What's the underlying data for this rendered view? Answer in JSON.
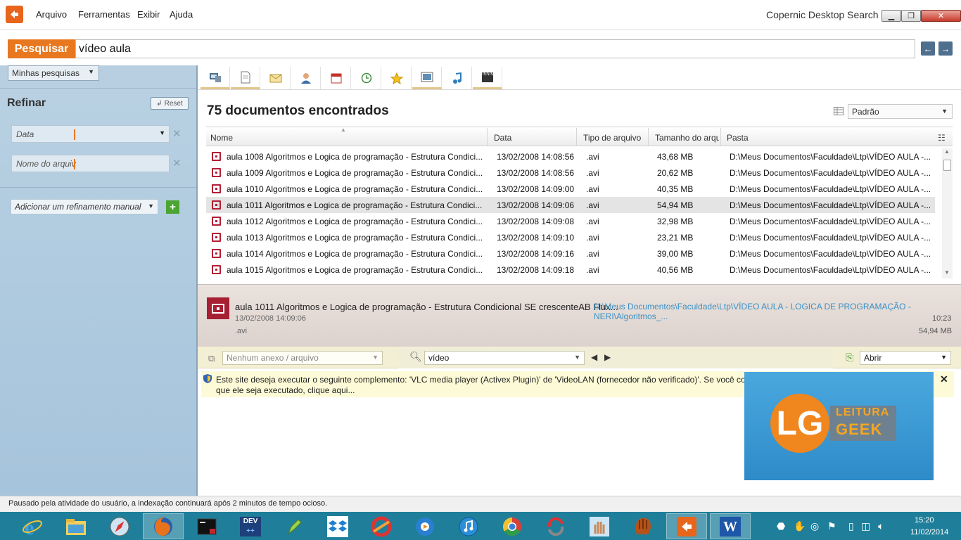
{
  "window": {
    "title": "Copernic Desktop Search",
    "minimize_icon": "minimize-icon",
    "maximize_icon": "restore-icon",
    "close_icon": "close-icon"
  },
  "menu": [
    "Arquivo",
    "Ferramentas",
    "Exibir",
    "Ajuda"
  ],
  "search": {
    "button_label": "Pesquisar",
    "query": "vídeo aula",
    "back_icon": "arrow-left-icon",
    "forward_icon": "arrow-right-icon"
  },
  "sidebar": {
    "my_searches": "Minhas pesquisas",
    "refine_title": "Refinar",
    "reset_label": "Reset",
    "filters": [
      {
        "label": "Data"
      },
      {
        "label": "Nome do arquiv"
      }
    ],
    "add_refine": "Adicionar um refinamento manual",
    "add_icon": "plus-icon"
  },
  "toolbar_icons": [
    "all-results-icon",
    "files-icon",
    "email-icon",
    "contacts-icon",
    "calendar-icon",
    "history-icon",
    "favorites-icon",
    "pictures-icon",
    "music-icon",
    "videos-icon"
  ],
  "results": {
    "count_label": "75 documentos encontrados",
    "sort": "Padrão",
    "columns": [
      "Nome",
      "Data",
      "Tipo de arquivo",
      "Tamanho do arqu",
      "Pasta"
    ],
    "rows": [
      {
        "name": "aula 1008 Algoritmos e Logica de programação - Estrutura Condici...",
        "date": "13/02/2008 14:08:56",
        "type": ".avi",
        "size": "43,68 MB",
        "path": "D:\\Meus Documentos\\Faculdade\\Ltp\\VÍDEO AULA -..."
      },
      {
        "name": "aula 1009 Algoritmos e Logica de programação - Estrutura Condici...",
        "date": "13/02/2008 14:08:56",
        "type": ".avi",
        "size": "20,62 MB",
        "path": "D:\\Meus Documentos\\Faculdade\\Ltp\\VÍDEO AULA -..."
      },
      {
        "name": "aula 1010 Algoritmos e Logica de programação - Estrutura Condici...",
        "date": "13/02/2008 14:09:00",
        "type": ".avi",
        "size": "40,35 MB",
        "path": "D:\\Meus Documentos\\Faculdade\\Ltp\\VÍDEO AULA -..."
      },
      {
        "name": "aula 1011 Algoritmos e Logica de programação - Estrutura Condici...",
        "date": "13/02/2008 14:09:06",
        "type": ".avi",
        "size": "54,94 MB",
        "path": "D:\\Meus Documentos\\Faculdade\\Ltp\\VÍDEO AULA -..."
      },
      {
        "name": "aula 1012 Algoritmos e Logica de programação - Estrutura Condici...",
        "date": "13/02/2008 14:09:08",
        "type": ".avi",
        "size": "32,98 MB",
        "path": "D:\\Meus Documentos\\Faculdade\\Ltp\\VÍDEO AULA -..."
      },
      {
        "name": "aula 1013 Algoritmos e Logica de programação - Estrutura Condici...",
        "date": "13/02/2008 14:09:10",
        "type": ".avi",
        "size": "23,21 MB",
        "path": "D:\\Meus Documentos\\Faculdade\\Ltp\\VÍDEO AULA -..."
      },
      {
        "name": "aula 1014 Algoritmos e Logica de programação - Estrutura Condici...",
        "date": "13/02/2008 14:09:16",
        "type": ".avi",
        "size": "39,00 MB",
        "path": "D:\\Meus Documentos\\Faculdade\\Ltp\\VÍDEO AULA -..."
      },
      {
        "name": "aula 1015 Algoritmos e Logica de programação - Estrutura Condici...",
        "date": "13/02/2008 14:09:18",
        "type": ".avi",
        "size": "40,56 MB",
        "path": "D:\\Meus Documentos\\Faculdade\\Ltp\\VÍDEO AULA -..."
      }
    ]
  },
  "preview": {
    "name": "aula 1011 Algoritmos e Logica de programação - Estrutura Condicional SE crescenteAB Flux...",
    "date": "13/02/2008 14:09:06",
    "ext": ".avi",
    "path": "D:\\Meus Documentos\\Faculdade\\Ltp\\VÍDEO AULA - LOGICA DE PROGRAMAÇÃO - NERI\\Algoritmos_...",
    "time": "10:23",
    "size": "54,94 MB"
  },
  "bottom": {
    "attachments": "Nenhum anexo / arquivo",
    "find_value": "vídeo",
    "open_label": "Abrir"
  },
  "infobar": {
    "text": "Este site deseja executar o seguinte complemento: 'VLC media player (Activex Plugin)' de 'VideoLAN (fornecedor não verificado)'. Se você confia no site e no complemento e deseja permitir que ele seja executado, clique aqui...",
    "close": "✕"
  },
  "watermark": {
    "logo": "LG",
    "line1": "LEITURA",
    "line2": "GEEK"
  },
  "status": "Pausado pela atividade do usuário, a indexação continuará após 2 minutos de tempo ocioso.",
  "taskbar": {
    "apps": [
      "internet-explorer-icon",
      "file-explorer-icon",
      "safari-icon",
      "firefox-icon",
      "terminal-icon",
      "devcpp-icon",
      "pen-icon",
      "dropbox-icon",
      "ccleaner-icon",
      "media-player-icon",
      "itunes-icon",
      "chrome-icon",
      "refresh-app-icon",
      "hand-icon",
      "baseball-glove-icon",
      "copernic-icon",
      "word-icon"
    ],
    "time": "15:20",
    "date": "11/02/2014",
    "dev_label": "DEV",
    "word_label": "W"
  },
  "colors": {
    "accent": "#e8781f",
    "sidebar": "#b9d1e2",
    "file_icon": "#b31f34",
    "link": "#3a8fc4"
  }
}
